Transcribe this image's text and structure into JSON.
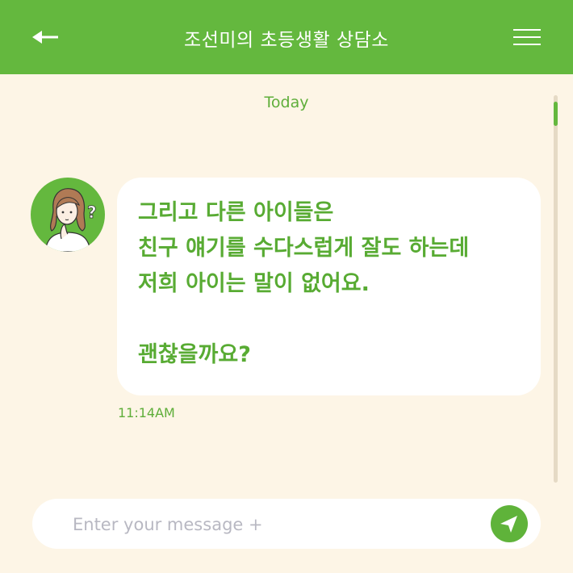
{
  "header": {
    "title": "조선미의 초등생활 상담소",
    "back_icon": "back-arrow-icon",
    "menu_icon": "hamburger-menu-icon",
    "background_color": "#64b83e"
  },
  "chat": {
    "date_label": "Today",
    "messages": [
      {
        "sender_avatar": "counselor-avatar",
        "text": "그리고 다른 아이들은\n친구 얘기를 수다스럽게 잘도 하는데\n저희 아이는 말이 없어요.\n\n괜찮을까요?",
        "time": "11:14AM"
      }
    ]
  },
  "composer": {
    "placeholder": "Enter your message +",
    "value": "",
    "send_icon": "send-icon"
  },
  "colors": {
    "accent": "#64b83e",
    "background": "#fdf5e6",
    "bubble": "#ffffff",
    "text_accent": "#58ab33"
  }
}
